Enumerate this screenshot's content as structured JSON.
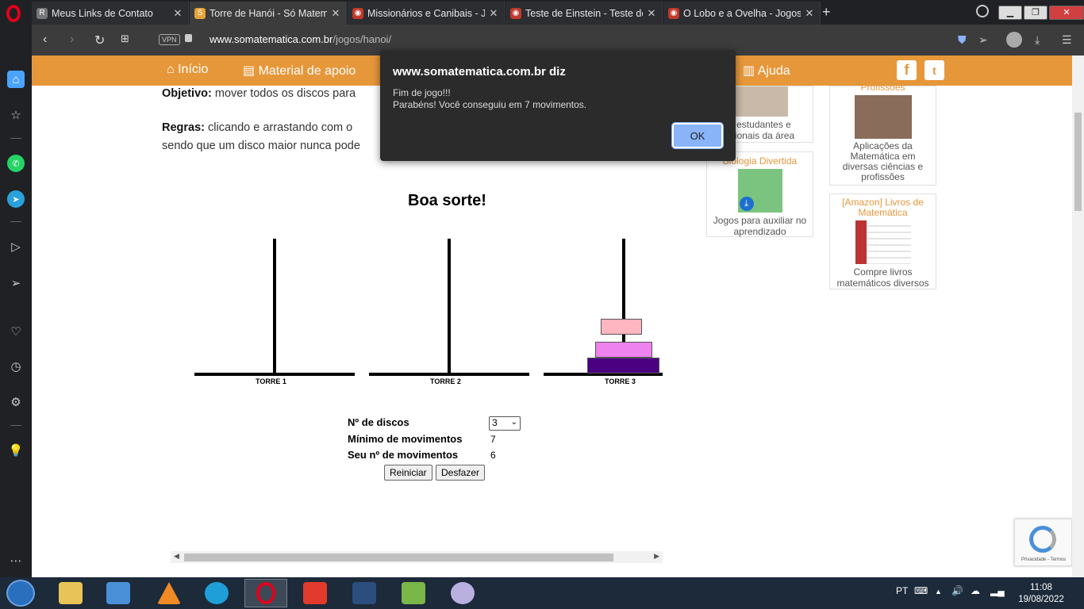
{
  "browser": {
    "tabs": [
      {
        "title": "Meus Links de Contato",
        "favicon_color": "#777777"
      },
      {
        "title": "Torre de Hanói - Só Matem",
        "favicon_color": "#e6a23a"
      },
      {
        "title": "Missionários e Canibais - Jo",
        "favicon_color": "#c0392b"
      },
      {
        "title": "Teste de Einstein - Teste de",
        "favicon_color": "#c0392b"
      },
      {
        "title": "O Lobo e a Ovelha - Jogos",
        "favicon_color": "#c0392b"
      }
    ],
    "active_tab_index": 1,
    "new_tab_label": "+",
    "url_host": "www.somatematica.com.br",
    "url_path": "/jogos/hanoi/",
    "vpn_label": "VPN"
  },
  "site_nav": {
    "items": [
      "Início",
      "Material de apoio",
      "Ajuda"
    ]
  },
  "content": {
    "objective_label": "Objetivo:",
    "objective_text": "mover todos os discos para",
    "rules_label": "Regras:",
    "rules_line1": "clicando e arrastando com o",
    "rules_line2": "sendo que um disco maior nunca pode",
    "good_luck": "Boa sorte!"
  },
  "game": {
    "towers": [
      "TORRE 1",
      "TORRE 2",
      "TORRE 3"
    ],
    "disks_on_tower3": [
      {
        "size": 3,
        "color": "#4b0082"
      },
      {
        "size": 2,
        "color": "#ee82ee"
      },
      {
        "size": 1,
        "color": "#ffb6c1"
      }
    ],
    "num_disks_label": "Nº de discos",
    "num_disks_value": "3",
    "min_moves_label": "Mínimo de movimentos",
    "min_moves_value": "7",
    "your_moves_label": "Seu nº de movimentos",
    "your_moves_value": "6",
    "restart_label": "Reiniciar",
    "undo_label": "Desfazer"
  },
  "sidebar_cards": {
    "card1_text_line1": "a estudantes e",
    "card1_text_line2": "ssionais da área",
    "card2_title": "Profissões",
    "card2_text": "Aplicações da Matemática em diversas ciências e profissões",
    "card3_title": "Biologia Divertida",
    "card3_text": "Jogos para auxiliar no aprendizado",
    "card4_title": "[Amazon] Livros de Matemática",
    "card4_text": "Compre livros matemáticos diversos"
  },
  "recaptcha": {
    "text": "Privacidade - Termos"
  },
  "dialog": {
    "origin": "www.somatematica.com.br diz",
    "line1": "Fim de jogo!!!",
    "line2": "Parabéns! Você conseguiu em 7 movimentos.",
    "ok_label": "OK"
  },
  "taskbar": {
    "language": "PT",
    "time": "11:08",
    "date": "19/08/2022"
  }
}
